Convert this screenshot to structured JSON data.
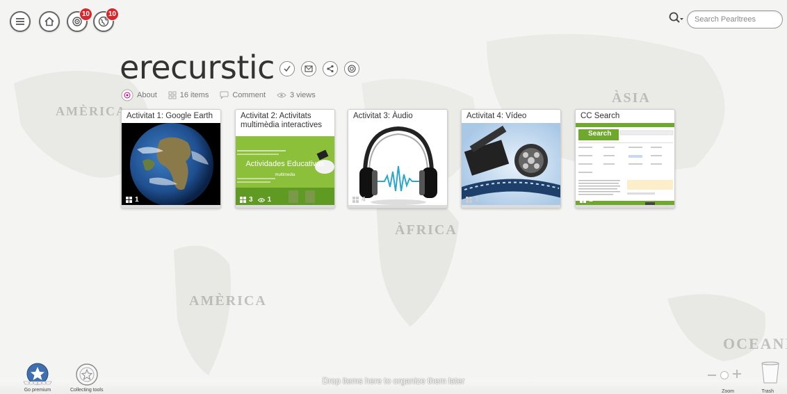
{
  "topbar": {
    "notifications_badge": "10",
    "pearls_badge": "10",
    "search_placeholder": "Search Pearltrees"
  },
  "map_labels": [
    "AMÈRICA",
    "ÀSIA",
    "ÀFRICA",
    "AMÈRICA",
    "OCEANI"
  ],
  "collection": {
    "title": "erecurstic",
    "about_label": "About",
    "items_label": "16 items",
    "comment_label": "Comment",
    "views_label": "3 views"
  },
  "cards": [
    {
      "title": "Activitat 1: Google Earth",
      "count": "1"
    },
    {
      "title": "Activitat 2: Activitats multimèdia interactives",
      "count": "3",
      "extra": "1",
      "img_heading": "Actividades Educativas",
      "img_sub": "multimedia"
    },
    {
      "title": "Activitat 3: Àudio",
      "count": "4"
    },
    {
      "title": "Activitat 4: Vídeo",
      "count": "3"
    },
    {
      "title": "CC Search",
      "count": "1",
      "img_logo": "Search"
    }
  ],
  "bottom": {
    "go_premium_label": "Go premium",
    "collecting_tools_label": "Collecting tools",
    "drop_text": "Drop items here to organize them later",
    "zoom_label": "Zoom",
    "trash_label": "Trash"
  },
  "colors": {
    "badge": "#d9262b",
    "premium_blue": "#3f6fae",
    "card_green": "#7fb82c"
  }
}
